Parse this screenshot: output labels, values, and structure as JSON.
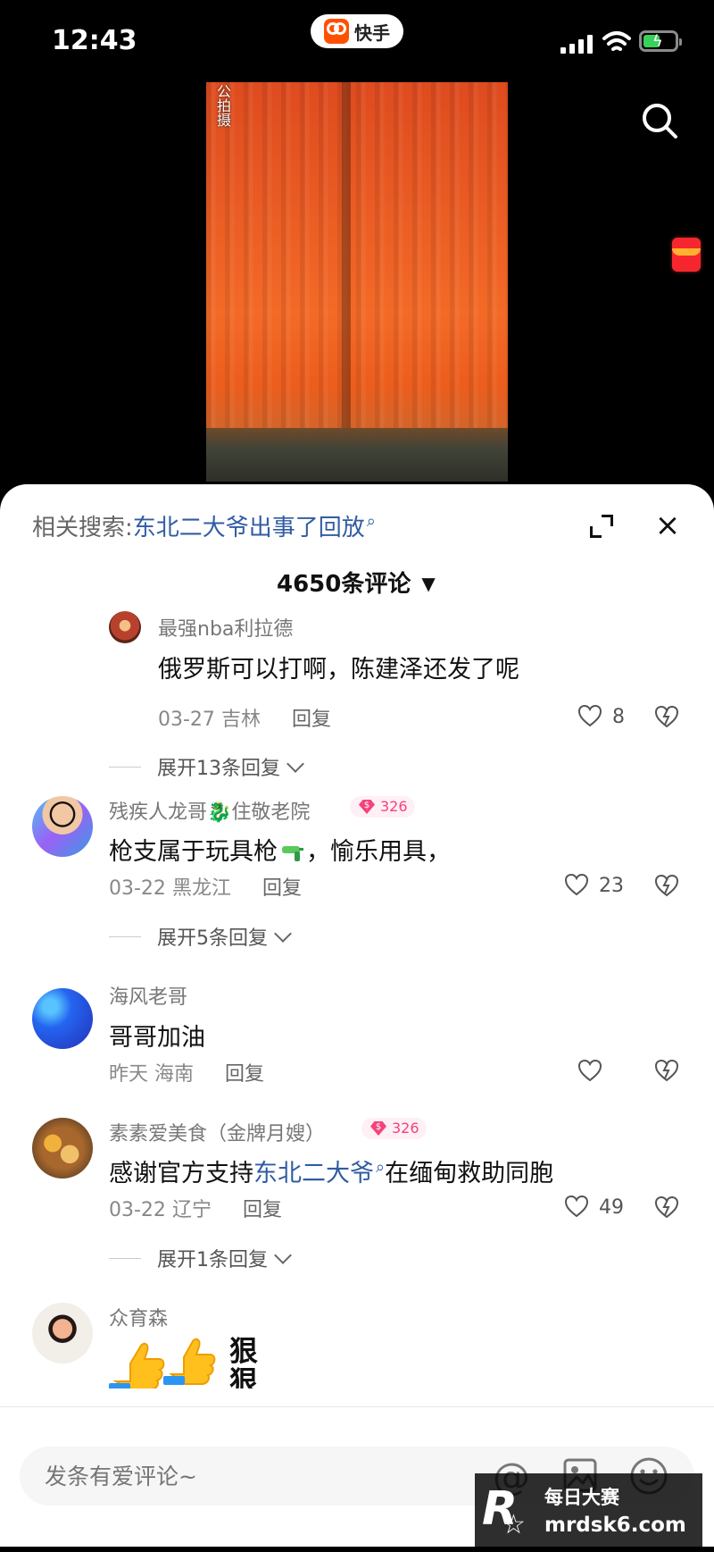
{
  "status": {
    "time": "12:43",
    "app_name": "快手"
  },
  "video": {
    "overlay_text": "公拍摄"
  },
  "panel": {
    "related_label": "相关搜索:",
    "related_query": "东北二大爷出事了回放",
    "comment_count": "4650",
    "comment_count_suffix": "条评论"
  },
  "comments": [
    {
      "name": "最强nba利拉德",
      "text": "俄罗斯可以打啊，陈建泽还发了呢",
      "date": "03-27",
      "location": "吉林",
      "reply_label": "回复",
      "likes": "8",
      "expand_label": "展开13条回复"
    },
    {
      "name_before_icon": "残疾人龙哥",
      "name_after_icon": "住敬老院",
      "badge": "326",
      "text_before_icon": "枪支属于玩具枪",
      "text_after_icon": "，愉乐用具，",
      "date": "03-22",
      "location": "黑龙江",
      "reply_label": "回复",
      "likes": "23",
      "expand_label": "展开5条回复"
    },
    {
      "name": "海风老哥",
      "text": "哥哥加油",
      "date": "昨天",
      "location": "海南",
      "reply_label": "回复"
    },
    {
      "name": "素素爱美食（金牌月嫂）",
      "badge": "326",
      "text_prefix": "感谢官方支持",
      "text_link": "东北二大爷",
      "text_suffix": "在缅甸救助同胞",
      "date": "03-22",
      "location": "辽宁",
      "reply_label": "回复",
      "likes": "49",
      "expand_label": "展开1条回复"
    },
    {
      "name": "众育森",
      "sticker_text": "狠狠"
    }
  ],
  "input": {
    "placeholder": "发条有爱评论~"
  },
  "watermark": {
    "title": "每日大赛",
    "url": "mrdsk6.com"
  },
  "colors": {
    "brand": "#ff5000",
    "link": "#315ca3",
    "badge": "#f3437b",
    "status_green": "#38d15b"
  },
  "icons": [
    "search-icon",
    "expand-icon",
    "close-icon",
    "heart-icon",
    "dislike-icon",
    "at-icon",
    "image-icon",
    "smile-icon"
  ]
}
